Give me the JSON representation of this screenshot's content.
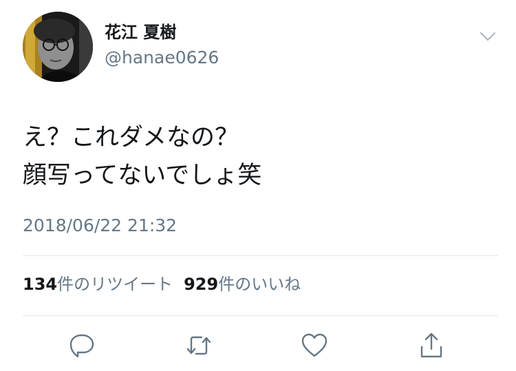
{
  "user": {
    "display_name": "花江 夏樹",
    "handle": "@hanae0626",
    "avatar_icon": "profile-photo"
  },
  "menu": {
    "icon": "chevron-down-icon"
  },
  "tweet": {
    "line1": "え？これダメなの？",
    "line2": "顔写ってないでしょ笑",
    "timestamp": "2018/06/22 21:32"
  },
  "stats": {
    "retweets_count": "134",
    "retweets_label": "件のリツイート",
    "likes_count": "929",
    "likes_label": "件のいいね"
  },
  "actions": [
    {
      "icon": "reply-icon"
    },
    {
      "icon": "retweet-icon"
    },
    {
      "icon": "like-icon"
    },
    {
      "icon": "share-icon"
    }
  ],
  "colors": {
    "text": "#14171a",
    "secondary": "#657786",
    "divider": "#e1e8ed",
    "icon": "#657786"
  }
}
